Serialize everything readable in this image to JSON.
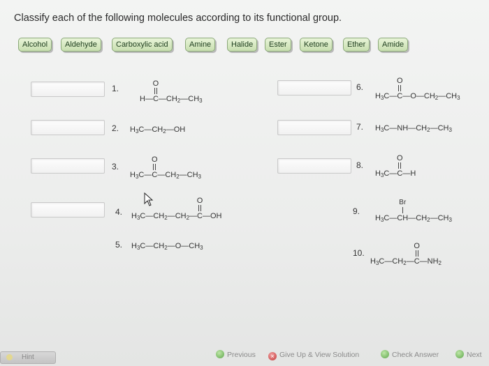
{
  "question": {
    "title": "Classify each of the following molecules according to its functional group."
  },
  "chips": [
    "Alcohol",
    "Aldehyde",
    "Carboxylic acid",
    "Amine",
    "Halide",
    "Ester",
    "Ketone",
    "Ether",
    "Amide"
  ],
  "molecules": {
    "m1": {
      "num": "1.",
      "carbonyl_o": "O",
      "p1": "H",
      "p2": "C",
      "p3": "CH",
      "s3": "2",
      "p4": "—CH",
      "s4": "3"
    },
    "m2": {
      "num": "2.",
      "a": "H",
      "as": "3",
      "b": "C—CH",
      "bs": "2",
      "c": "—OH"
    },
    "m3": {
      "num": "3.",
      "carbonyl_o": "O",
      "a": "H",
      "as": "3",
      "b": "C—",
      "c": "C",
      "d": "—CH",
      "ds": "2",
      "e": "—CH",
      "es": "3"
    },
    "m4": {
      "num": "4.",
      "carbonyl_o": "O",
      "a": "H",
      "as": "3",
      "b": "C—CH",
      "bs": "2",
      "c": "—CH",
      "cs": "2",
      "d": "—",
      "e": "C",
      "f": "—OH"
    },
    "m5": {
      "num": "5.",
      "a": "H",
      "as": "3",
      "b": "C—CH",
      "bs": "2",
      "c": "—O—CH",
      "cs": "3"
    },
    "m6": {
      "num": "6.",
      "carbonyl_o": "O",
      "a": "H",
      "as": "3",
      "b": "C—",
      "c": "C",
      "d": "—O—CH",
      "ds": "2",
      "e": "—CH",
      "es": "3"
    },
    "m7": {
      "num": "7.",
      "a": "H",
      "as": "3",
      "b": "C—NH—CH",
      "bs": "2",
      "c": "—CH",
      "cs": "3"
    },
    "m8": {
      "num": "8.",
      "carbonyl_o": "O",
      "a": "H",
      "as": "3",
      "b": "C—",
      "c": "C",
      "d": "—H"
    },
    "m9": {
      "num": "9.",
      "subst": "Br",
      "a": "H",
      "as": "3",
      "b": "C—",
      "c": "CH",
      "d": "—CH",
      "ds": "2",
      "e": "—CH",
      "es": "3"
    },
    "m10": {
      "num": "10.",
      "carbonyl_o": "O",
      "a": "H",
      "as": "3",
      "b": "C—CH",
      "bs": "2",
      "c": "—",
      "d": "C",
      "e": "—NH",
      "es": "2"
    }
  },
  "footer": {
    "hint": "Hint",
    "previous": "Previous",
    "give_up": "Give Up & View Solution",
    "check": "Check Answer",
    "next": "Next"
  },
  "colors": {
    "chip_bg": "#d6ebc2",
    "chip_border": "#8aa878",
    "slot_border": "#c9c9c9"
  }
}
